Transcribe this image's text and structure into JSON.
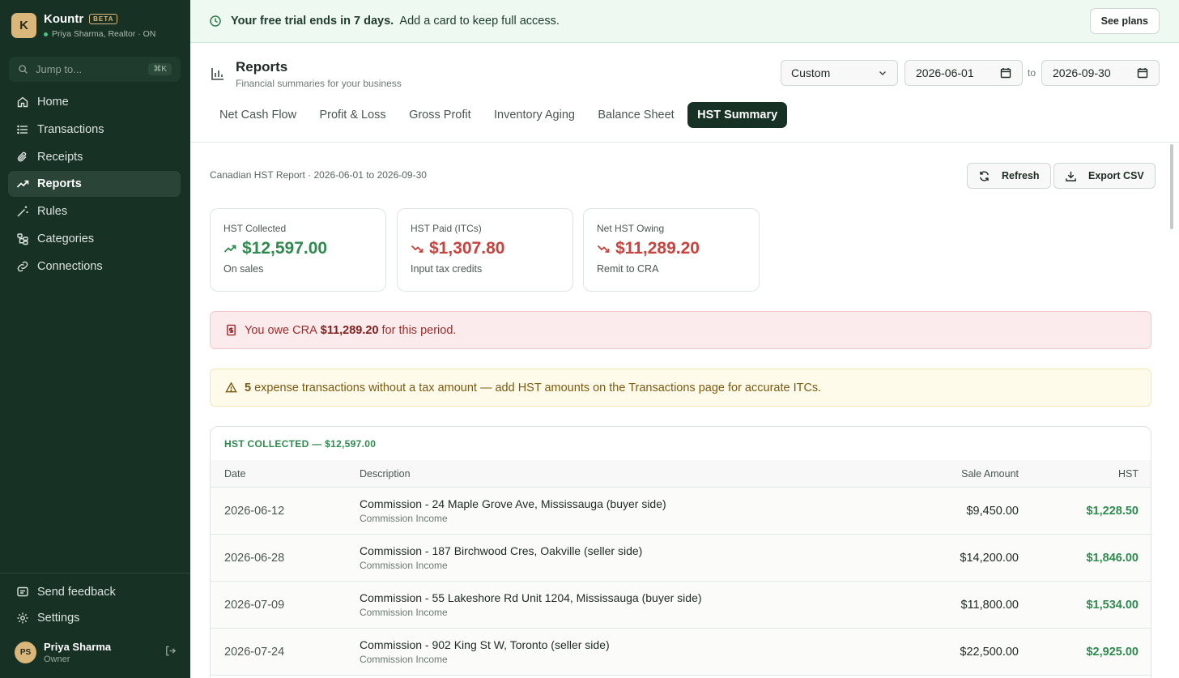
{
  "brand": {
    "logo_letter": "K",
    "name": "Kountr",
    "badge": "BETA",
    "sub": "Priya Sharma, Realtor · ON"
  },
  "search": {
    "placeholder": "Jump to...",
    "shortcut": "⌘K"
  },
  "nav": [
    {
      "label": "Home",
      "icon": "home-icon"
    },
    {
      "label": "Transactions",
      "icon": "list-icon"
    },
    {
      "label": "Receipts",
      "icon": "paperclip-icon"
    },
    {
      "label": "Reports",
      "icon": "trending-up-icon",
      "active": true
    },
    {
      "label": "Rules",
      "icon": "wand-icon"
    },
    {
      "label": "Categories",
      "icon": "folder-tree-icon"
    },
    {
      "label": "Connections",
      "icon": "link-icon"
    }
  ],
  "sidebar_bottom": {
    "feedback": "Send feedback",
    "settings": "Settings"
  },
  "user": {
    "initials": "PS",
    "name": "Priya Sharma",
    "role": "Owner"
  },
  "trial": {
    "strong": "Your free trial ends in 7 days.",
    "rest": "Add a card to keep full access.",
    "button": "See plans"
  },
  "header": {
    "title": "Reports",
    "subtitle": "Financial summaries for your business",
    "range_select": "Custom",
    "date_from": "2026-06-01",
    "to_label": "to",
    "date_to": "2026-09-30"
  },
  "tabs": [
    "Net Cash Flow",
    "Profit & Loss",
    "Gross Profit",
    "Inventory Aging",
    "Balance Sheet",
    "HST Summary"
  ],
  "active_tab": "HST Summary",
  "report": {
    "title": "Canadian HST Report · 2026-06-01 to 2026-09-30",
    "refresh": "Refresh",
    "export": "Export CSV"
  },
  "cards": [
    {
      "label": "HST Collected",
      "value": "$12,597.00",
      "sub": "On sales",
      "trend": "up"
    },
    {
      "label": "HST Paid (ITCs)",
      "value": "$1,307.80",
      "sub": "Input tax credits",
      "trend": "down"
    },
    {
      "label": "Net HST Owing",
      "value": "$11,289.20",
      "sub": "Remit to CRA",
      "trend": "down"
    }
  ],
  "owe_alert": {
    "pre": "You owe CRA",
    "amount": "$11,289.20",
    "post": "for this period."
  },
  "warn_alert": {
    "count": "5",
    "text": "expense transactions without a tax amount — add HST amounts on the Transactions page for accurate ITCs."
  },
  "table": {
    "title": "HST COLLECTED — $12,597.00",
    "headers": {
      "date": "Date",
      "description": "Description",
      "amount": "Sale Amount",
      "hst": "HST"
    },
    "rows": [
      {
        "date": "2026-06-12",
        "desc": "Commission - 24 Maple Grove Ave, Mississauga (buyer side)",
        "category": "Commission Income",
        "amount": "$9,450.00",
        "hst": "$1,228.50"
      },
      {
        "date": "2026-06-28",
        "desc": "Commission - 187 Birchwood Cres, Oakville (seller side)",
        "category": "Commission Income",
        "amount": "$14,200.00",
        "hst": "$1,846.00"
      },
      {
        "date": "2026-07-09",
        "desc": "Commission - 55 Lakeshore Rd Unit 1204, Mississauga (buyer side)",
        "category": "Commission Income",
        "amount": "$11,800.00",
        "hst": "$1,534.00"
      },
      {
        "date": "2026-07-24",
        "desc": "Commission - 902 King St W, Toronto (seller side)",
        "category": "Commission Income",
        "amount": "$22,500.00",
        "hst": "$2,925.00"
      }
    ]
  },
  "colors": {
    "sidebar": "#173124",
    "accent_green": "#2f8a4f",
    "accent_red": "#c9423e",
    "brand_gold": "#d9b77a"
  }
}
